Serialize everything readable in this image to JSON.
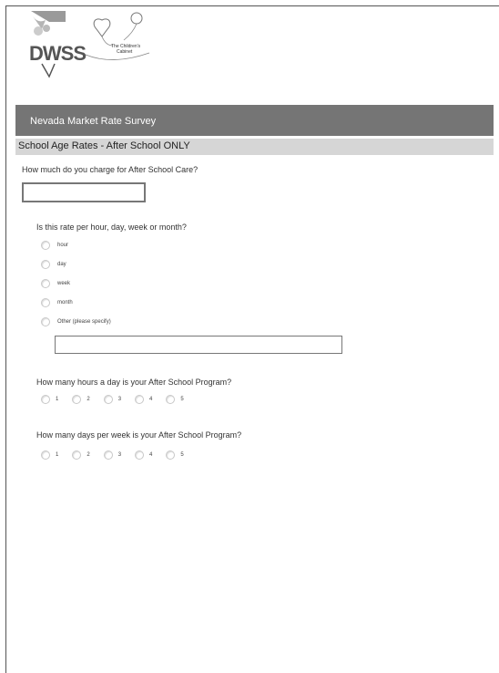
{
  "logos": {
    "dwss": "DWSS",
    "childrens_cabinet_line1": "The Children's",
    "childrens_cabinet_line2": "Cabinet"
  },
  "header": {
    "title": "Nevada Market Rate Survey"
  },
  "section": {
    "title": "School Age Rates - After School ONLY"
  },
  "q1": {
    "text": "How much do you charge for After School Care?",
    "value": ""
  },
  "q2": {
    "text": "Is this rate per hour, day, week or month?",
    "options": [
      "hour",
      "day",
      "week",
      "month",
      "Other (please specify)"
    ],
    "other_value": ""
  },
  "q3": {
    "text": "How many hours a day is your After School Program?",
    "options": [
      "1",
      "2",
      "3",
      "4",
      "5"
    ]
  },
  "q4": {
    "text": "How many days per week is your After School Program?",
    "options": [
      "1",
      "2",
      "3",
      "4",
      "5"
    ]
  },
  "colors": {
    "header_bg": "#757575",
    "section_bg": "#d6d6d6",
    "border": "#777777"
  }
}
